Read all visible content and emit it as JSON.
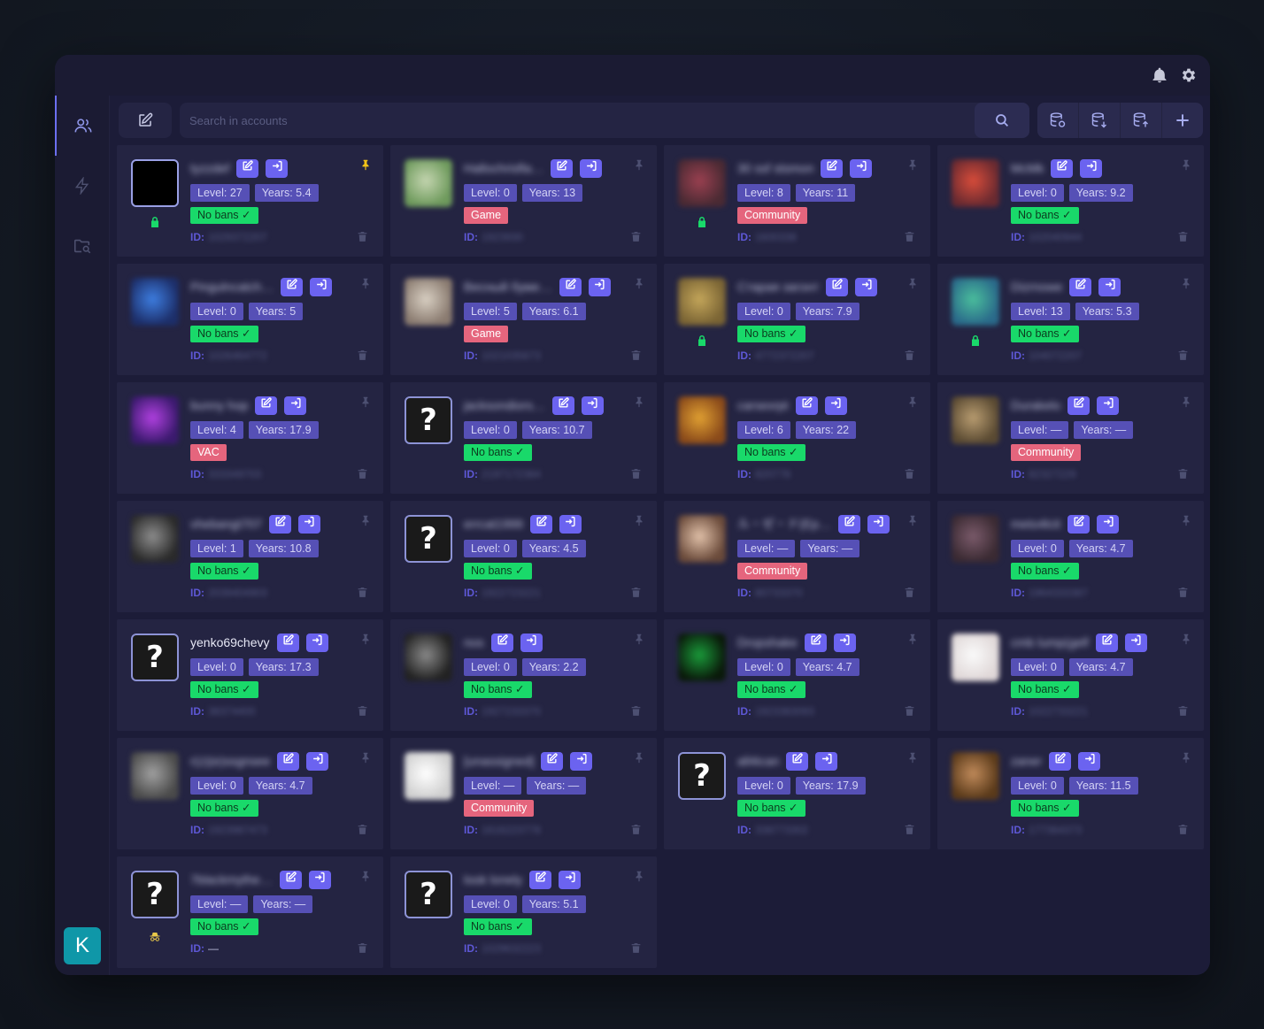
{
  "titlebar": {
    "icons": [
      "bell-icon",
      "gear-icon"
    ]
  },
  "sidebar": {
    "items": [
      {
        "name": "accounts-icon",
        "active": true
      },
      {
        "name": "lightning-icon",
        "active": false
      },
      {
        "name": "folder-search-icon",
        "active": false
      }
    ],
    "user_initial": "K"
  },
  "search": {
    "placeholder": "Search in accounts",
    "value": ""
  },
  "toolbar": {
    "buttons": [
      "database-refresh-icon",
      "database-import-icon",
      "database-export-icon",
      "add-icon"
    ]
  },
  "labels": {
    "level_prefix": "Level: ",
    "years_prefix": "Years: ",
    "id_prefix": "ID:"
  },
  "colors": {
    "accent": "#6b63f0",
    "ok": "#19d96a",
    "ban": "#e5657d",
    "pinned": "#f2c318",
    "card": "#242442"
  },
  "accounts": [
    {
      "name": "tyzzdef",
      "name_blurred": true,
      "avatar": "black",
      "level": "27",
      "years": "5.4",
      "badge": "No bans ✓",
      "badge_type": "ok",
      "id": "1029372207",
      "id_blurred": true,
      "pinned": true,
      "lock": true
    },
    {
      "name": "Hallochrisfla…",
      "name_blurred": true,
      "avatar": "img",
      "avatar_colors": [
        "#6e9a5c",
        "#c4d5b0"
      ],
      "level": "0",
      "years": "13",
      "badge": "Game",
      "badge_type": "ban",
      "id": "1923930",
      "id_blurred": true,
      "pinned": false,
      "lock": false
    },
    {
      "name": "30 ssf stsmon",
      "name_blurred": true,
      "avatar": "img",
      "avatar_colors": [
        "#4a2a33",
        "#9a4050"
      ],
      "level": "8",
      "years": "11",
      "badge": "Community",
      "badge_type": "ban",
      "id": "1600338",
      "id_blurred": true,
      "pinned": false,
      "lock": true
    },
    {
      "name": "McMk",
      "name_blurred": true,
      "avatar": "img",
      "avatar_colors": [
        "#6a2a30",
        "#d84c3a"
      ],
      "level": "0",
      "years": "9.2",
      "badge": "No bans ✓",
      "badge_type": "ok",
      "id": "102040944",
      "id_blurred": true,
      "pinned": false,
      "lock": false
    },
    {
      "name": "Pingulncatch…",
      "name_blurred": true,
      "avatar": "img",
      "avatar_colors": [
        "#1d2f6a",
        "#3d7de0"
      ],
      "level": "0",
      "years": "5",
      "badge": "No bans ✓",
      "badge_type": "ok",
      "id": "1026464772",
      "id_blurred": true,
      "pinned": false,
      "lock": false
    },
    {
      "name": "Весный буме…",
      "name_blurred": true,
      "avatar": "img",
      "avatar_colors": [
        "#8a7b70",
        "#d8cfc2"
      ],
      "level": "5",
      "years": "6.1",
      "badge": "Game",
      "badge_type": "ban",
      "id": "1021035673",
      "id_blurred": true,
      "pinned": false,
      "lock": false
    },
    {
      "name": "Старая загонт",
      "name_blurred": true,
      "avatar": "img",
      "avatar_colors": [
        "#7a6434",
        "#c4a65a"
      ],
      "level": "0",
      "years": "7.9",
      "badge": "No bans ✓",
      "badge_type": "ok",
      "id": "4772372207",
      "id_blurred": true,
      "pinned": false,
      "lock": true
    },
    {
      "name": "Dizrnowe",
      "name_blurred": true,
      "avatar": "img",
      "avatar_colors": [
        "#2a6a8a",
        "#4abe9c"
      ],
      "level": "13",
      "years": "5.3",
      "badge": "No bans ✓",
      "badge_type": "ok",
      "id": "104072207",
      "id_blurred": true,
      "pinned": false,
      "lock": true
    },
    {
      "name": "bunny hop",
      "name_blurred": true,
      "avatar": "img",
      "avatar_colors": [
        "#3b1a6e",
        "#b040e0"
      ],
      "level": "4",
      "years": "17.9",
      "badge": "VAC",
      "badge_type": "ban",
      "id": "333349703",
      "id_blurred": true,
      "pinned": false,
      "lock": false
    },
    {
      "name": "jacksondiors…",
      "name_blurred": true,
      "avatar": "question",
      "level": "0",
      "years": "10.7",
      "badge": "No bans ✓",
      "badge_type": "ok",
      "id": "2197172384",
      "id_blurred": true,
      "pinned": false,
      "lock": false
    },
    {
      "name": "carsexrpt",
      "name_blurred": true,
      "avatar": "img",
      "avatar_colors": [
        "#8a4a1a",
        "#e0a032"
      ],
      "level": "6",
      "years": "22",
      "badge": "No bans ✓",
      "badge_type": "ok",
      "id": "820778",
      "id_blurred": true,
      "pinned": false,
      "lock": false
    },
    {
      "name": "Durakelo",
      "name_blurred": true,
      "avatar": "img",
      "avatar_colors": [
        "#5a4a32",
        "#b89c70"
      ],
      "level": "—",
      "years": "—",
      "badge": "Community",
      "badge_type": "ban",
      "id": "82327229",
      "id_blurred": true,
      "pinned": false,
      "lock": false
    },
    {
      "name": "vhebangt707",
      "name_blurred": true,
      "avatar": "img",
      "avatar_colors": [
        "#2a2a2a",
        "#8c8c8c"
      ],
      "level": "1",
      "years": "10.8",
      "badge": "No bans ✓",
      "badge_type": "ok",
      "id": "2039404903",
      "id_blurred": true,
      "pinned": false,
      "lock": false
    },
    {
      "name": "errcat1999",
      "name_blurred": true,
      "avatar": "question",
      "level": "0",
      "years": "4.5",
      "badge": "No bans ✓",
      "badge_type": "ok",
      "id": "1922723221",
      "id_blurred": true,
      "pinned": false,
      "lock": false
    },
    {
      "name": "ル・ゼ・ド(Ep…",
      "name_blurred": true,
      "avatar": "img",
      "avatar_colors": [
        "#6a4a3a",
        "#e0c0a8"
      ],
      "level": "—",
      "years": "—",
      "badge": "Community",
      "badge_type": "ban",
      "id": "80733370",
      "id_blurred": true,
      "pinned": false,
      "lock": false
    },
    {
      "name": "meto4lcit",
      "name_blurred": true,
      "avatar": "img",
      "avatar_colors": [
        "#3a2a32",
        "#7a5a6a"
      ],
      "level": "0",
      "years": "4.7",
      "badge": "No bans ✓",
      "badge_type": "ok",
      "id": "1964333387",
      "id_blurred": true,
      "pinned": false,
      "lock": false
    },
    {
      "name": "yenko69chevy",
      "name_blurred": false,
      "avatar": "question",
      "level": "0",
      "years": "17.3",
      "badge": "No bans ✓",
      "badge_type": "ok",
      "id": "38374400",
      "id_blurred": true,
      "pinned": false,
      "lock": false
    },
    {
      "name": "nos",
      "name_blurred": true,
      "avatar": "img",
      "avatar_colors": [
        "#222",
        "#888"
      ],
      "level": "0",
      "years": "2.2",
      "badge": "No bans ✓",
      "badge_type": "ok",
      "id": "1927233370",
      "id_blurred": true,
      "pinned": false,
      "lock": false
    },
    {
      "name": "Dropshake",
      "name_blurred": true,
      "avatar": "img",
      "avatar_colors": [
        "#0a1a0a",
        "#1a9a3a"
      ],
      "level": "0",
      "years": "4.7",
      "badge": "No bans ✓",
      "badge_type": "ok",
      "id": "1923383093",
      "id_blurred": true,
      "pinned": false,
      "lock": false
    },
    {
      "name": "cmb lump(gelf",
      "name_blurred": true,
      "avatar": "img",
      "avatar_colors": [
        "#e0d8d8",
        "#fafafa"
      ],
      "level": "0",
      "years": "4.7",
      "badge": "No bans ✓",
      "badge_type": "ok",
      "id": "1022733221",
      "id_blurred": true,
      "pinned": false,
      "lock": false
    },
    {
      "name": "r(z)(e)ssgnsee",
      "name_blurred": true,
      "avatar": "img",
      "avatar_colors": [
        "#4a4a4a",
        "#a0a0a0"
      ],
      "level": "0",
      "years": "4.7",
      "badge": "No bans ✓",
      "badge_type": "ok",
      "id": "1923987473",
      "id_blurred": true,
      "pinned": false,
      "lock": false
    },
    {
      "name": "[unassigned]",
      "name_blurred": true,
      "avatar": "img",
      "avatar_colors": [
        "#cfcfcf",
        "#ffffff"
      ],
      "level": "—",
      "years": "—",
      "badge": "Community",
      "badge_type": "ban",
      "id": "1616223778",
      "id_blurred": true,
      "pinned": false,
      "lock": false
    },
    {
      "name": "all4ican",
      "name_blurred": true,
      "avatar": "question",
      "level": "0",
      "years": "17.9",
      "badge": "No bans ✓",
      "badge_type": "ok",
      "id": "338773302",
      "id_blurred": true,
      "pinned": false,
      "lock": false
    },
    {
      "name": "zaner",
      "name_blurred": true,
      "avatar": "img",
      "avatar_colors": [
        "#5a3a1a",
        "#c08a5a"
      ],
      "level": "0",
      "years": "11.5",
      "badge": "No bans ✓",
      "badge_type": "ok",
      "id": "177364373",
      "id_blurred": true,
      "pinned": false,
      "lock": false
    },
    {
      "name": "7blackmythe…",
      "name_blurred": true,
      "avatar": "question",
      "level": "—",
      "years": "—",
      "badge": "No bans ✓",
      "badge_type": "ok",
      "id": "—",
      "id_blurred": false,
      "pinned": false,
      "lock": false,
      "spy": true
    },
    {
      "name": "look lonely",
      "name_blurred": true,
      "avatar": "question",
      "level": "0",
      "years": "5.1",
      "badge": "No bans ✓",
      "badge_type": "ok",
      "id": "1029632223",
      "id_blurred": true,
      "pinned": false,
      "lock": false
    }
  ]
}
